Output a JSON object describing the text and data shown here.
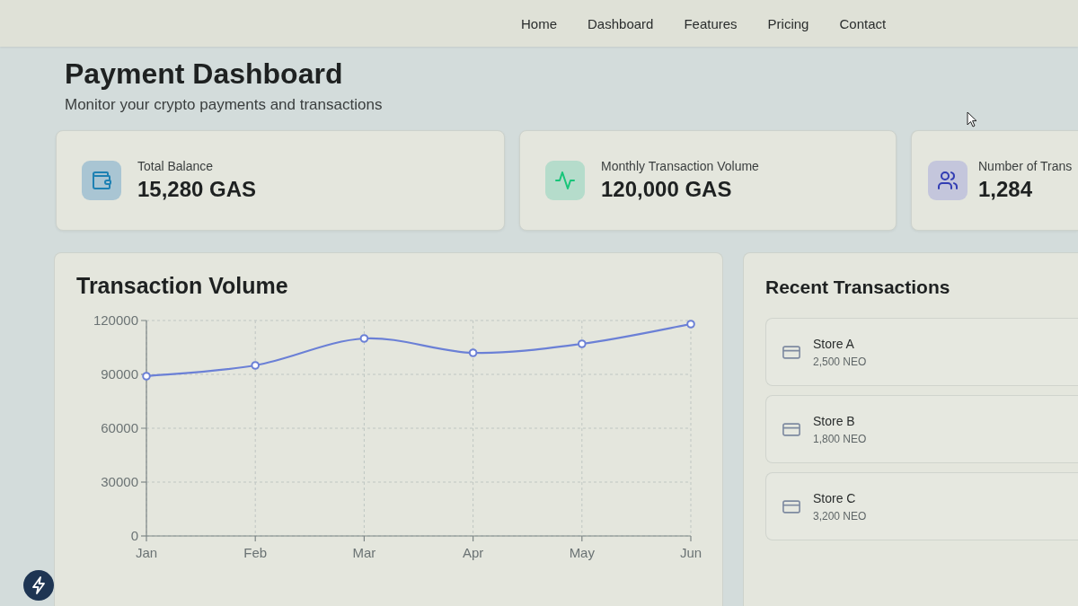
{
  "nav": {
    "links": [
      "Home",
      "Dashboard",
      "Features",
      "Pricing",
      "Contact"
    ]
  },
  "header": {
    "title": "Payment Dashboard",
    "subtitle": "Monitor your crypto payments and transactions"
  },
  "stats": [
    {
      "label": "Total Balance",
      "value": "15,280 GAS",
      "color": "#a9c5d3"
    },
    {
      "label": "Monthly Transaction Volume",
      "value": "120,000 GAS",
      "color": "#b5dccb"
    },
    {
      "label": "Number of Trans",
      "value": "1,284",
      "color": "#c4c6dc"
    }
  ],
  "transaction_volume": {
    "title": "Transaction Volume",
    "chart_data": {
      "type": "line",
      "categories": [
        "Jan",
        "Feb",
        "Mar",
        "Apr",
        "May",
        "Jun"
      ],
      "series": [
        {
          "color": "#6b80d6",
          "values": [
            89000,
            95000,
            110000,
            102000,
            107000,
            118000
          ],
          "marker": true
        }
      ],
      "ylim": [
        0,
        120000
      ],
      "yticks": [
        0,
        30000,
        60000,
        90000,
        120000
      ],
      "grid": true
    }
  },
  "recent_transactions": {
    "title": "Recent Transactions",
    "items": [
      {
        "name": "Store A",
        "amount": "2,500 NEO"
      },
      {
        "name": "Store B",
        "amount": "1,800 NEO"
      },
      {
        "name": "Store C",
        "amount": "3,200 NEO"
      }
    ]
  }
}
